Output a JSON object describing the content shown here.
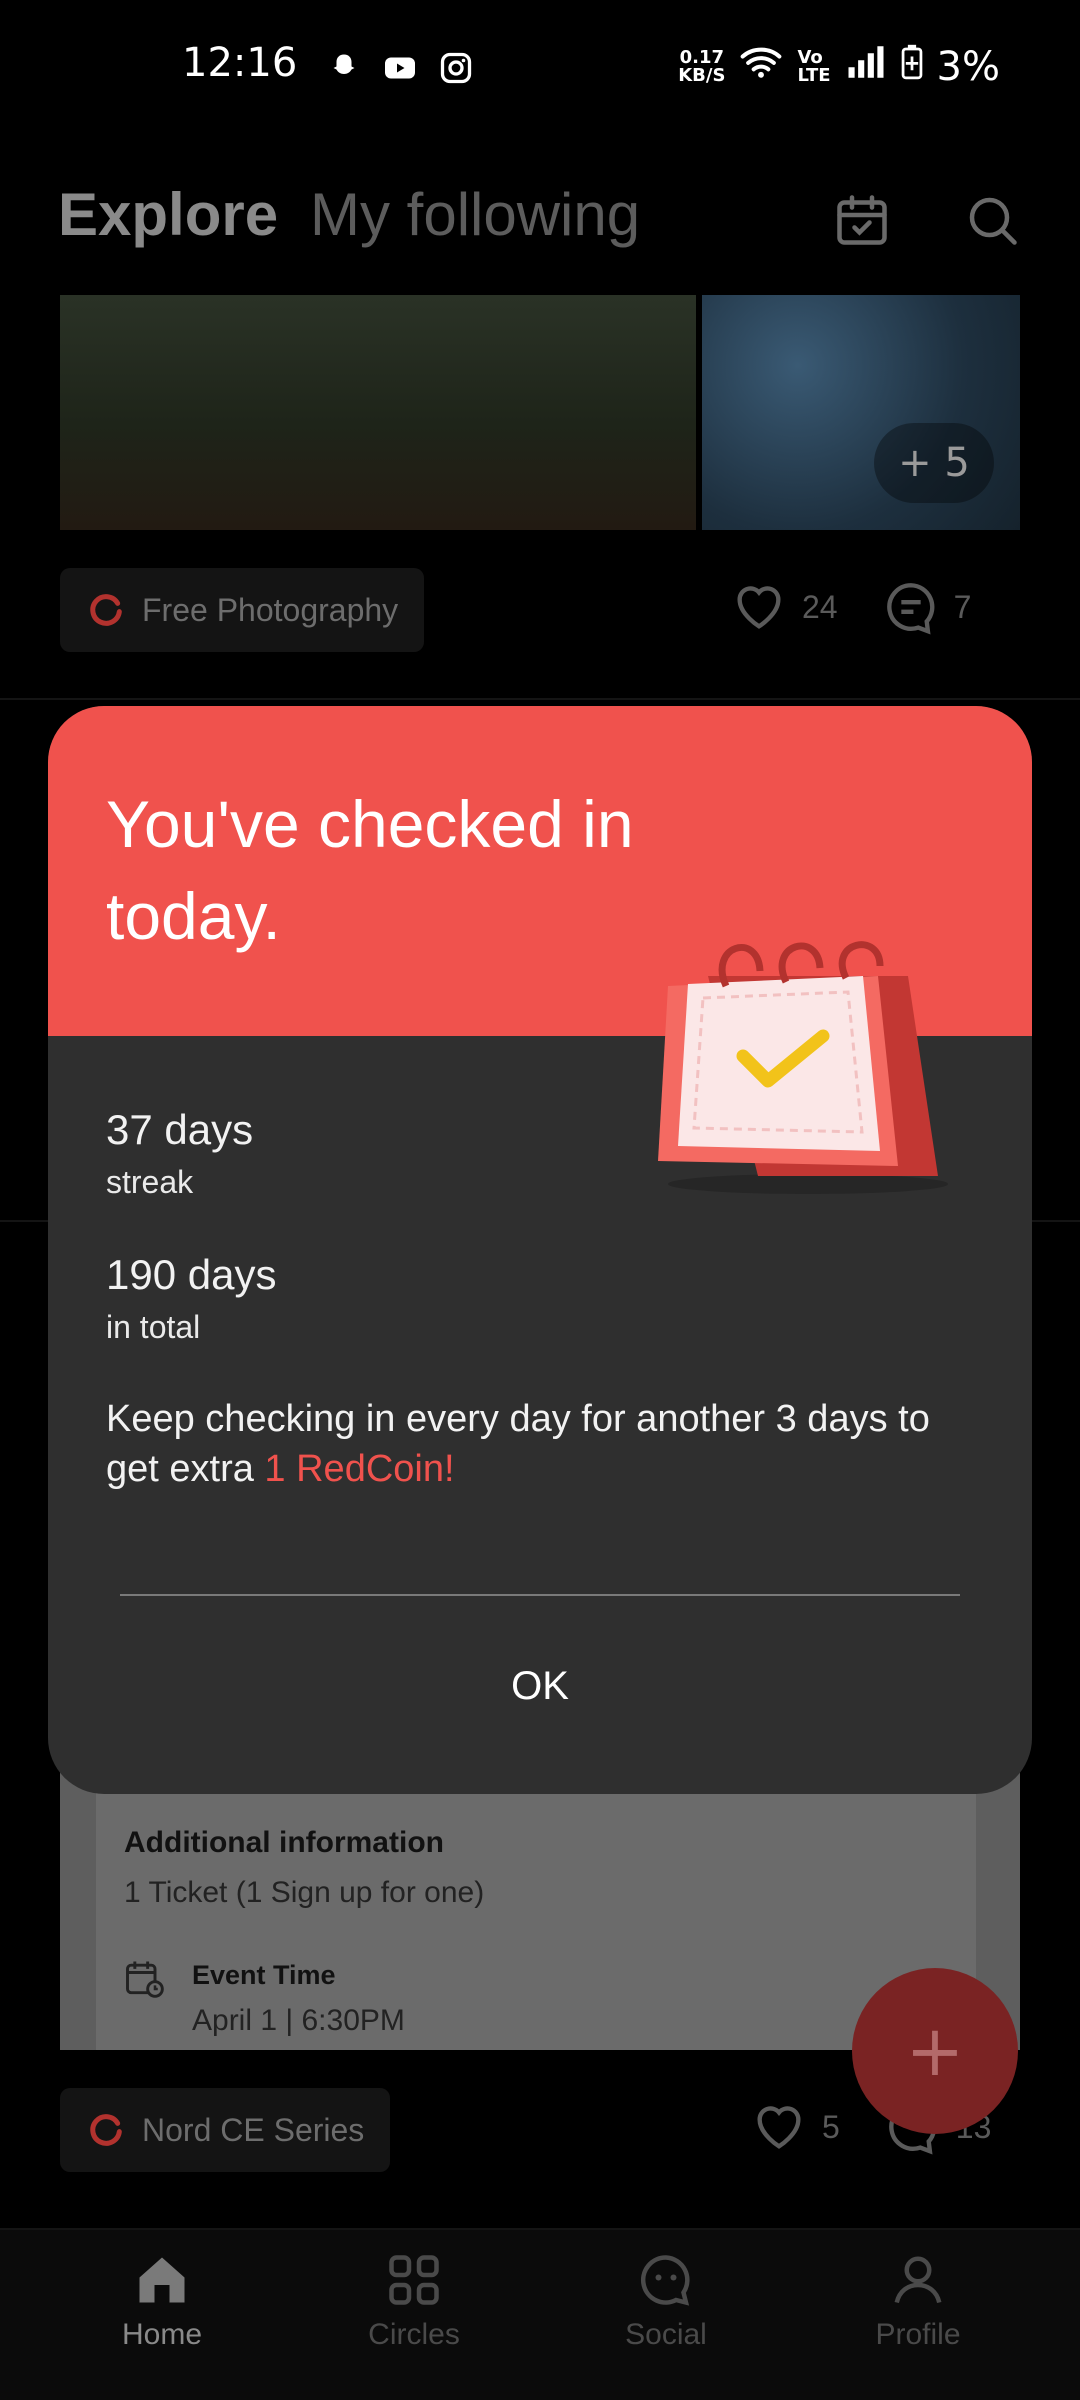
{
  "status_bar": {
    "time": "12:16",
    "speed_value": "0.17",
    "speed_unit": "KB/S",
    "lte_top": "Vo",
    "lte_bottom": "LTE",
    "battery": "3%"
  },
  "header": {
    "tabs": [
      {
        "label": "Explore",
        "active": true
      },
      {
        "label": "My following",
        "active": false
      }
    ]
  },
  "feed": {
    "post1": {
      "more_photos": "+ 5",
      "circle": "Free Photography",
      "likes": "24",
      "comments": "7"
    },
    "post2": {
      "additional_info_title": "Additional information",
      "additional_info_value": "1 Ticket (1 Sign up for one)",
      "event_time_label": "Event Time",
      "event_time_value": "April 1 | 6:30PM",
      "circle": "Nord CE Series",
      "likes": "5",
      "comments": "13"
    },
    "fab_label": "+"
  },
  "dialog": {
    "title": "You've checked in today.",
    "streak_value": "37 days",
    "streak_label": "streak",
    "total_value": "190 days",
    "total_label": "in total",
    "message": "Keep checking in every day for another 3 days to get extra ",
    "reward": "1 RedCoin!",
    "ok_label": "OK"
  },
  "bottom_nav": [
    {
      "label": "Home",
      "icon": "home-icon",
      "active": true
    },
    {
      "label": "Circles",
      "icon": "circles-icon",
      "active": false
    },
    {
      "label": "Social",
      "icon": "social-icon",
      "active": false
    },
    {
      "label": "Profile",
      "icon": "profile-icon",
      "active": false
    }
  ],
  "colors": {
    "accent": "#f0524d",
    "dialog_bg": "#2f2f2f",
    "background": "#000000"
  }
}
